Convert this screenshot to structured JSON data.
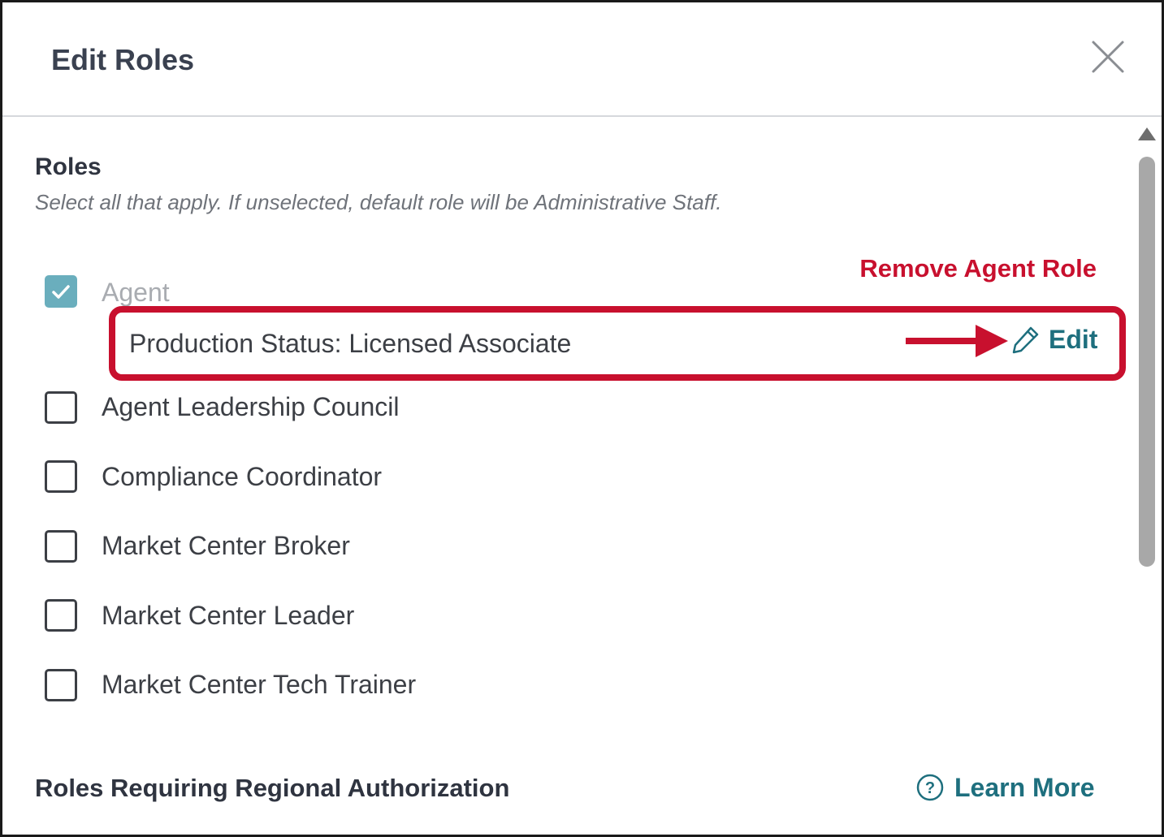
{
  "dialog": {
    "title": "Edit Roles",
    "close_icon": "close-icon"
  },
  "roles": {
    "title": "Roles",
    "hint": "Select all that apply. If unselected, default role will be Administrative Staff.",
    "remove_agent_role": "Remove Agent Role",
    "agent": {
      "label": "Agent",
      "checked": true,
      "production_status": "Production Status: Licensed Associate",
      "edit_label": "Edit",
      "edit_icon": "pencil-icon"
    },
    "items": [
      {
        "label": "Agent Leadership Council",
        "checked": false
      },
      {
        "label": "Compliance Coordinator",
        "checked": false
      },
      {
        "label": "Market Center Broker",
        "checked": false
      },
      {
        "label": "Market Center Leader",
        "checked": false
      },
      {
        "label": "Market Center Tech Trainer",
        "checked": false
      }
    ]
  },
  "regional": {
    "title": "Roles Requiring Regional Authorization",
    "learn_more": "Learn More",
    "learn_more_icon": "question-circle-icon"
  },
  "colors": {
    "accent": "#1e6f7e",
    "danger": "#c8102e",
    "checked": "#6aaebd"
  }
}
